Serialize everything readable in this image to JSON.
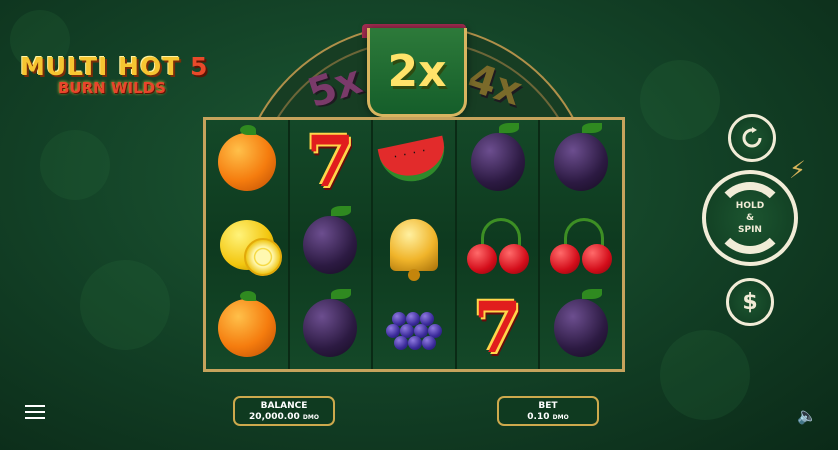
{
  "game": {
    "title_main": "MULTI HOT",
    "title_number": "5",
    "title_sub": "BURN WILDS"
  },
  "multipliers": {
    "left_edge": "",
    "five": "5x",
    "active": "2x",
    "four": "4x",
    "three": ""
  },
  "reels": [
    [
      "orange",
      "lemon",
      "orange"
    ],
    [
      "seven",
      "plum",
      "plum"
    ],
    [
      "watermelon",
      "bell",
      "grapes"
    ],
    [
      "plum",
      "cherry",
      "seven"
    ],
    [
      "plum",
      "cherry",
      "plum"
    ]
  ],
  "symbols": {
    "seven": "7"
  },
  "controls": {
    "spin_label_1": "HOLD",
    "spin_label_2": "&",
    "spin_label_3": "SPIN",
    "autoplay_icon": "autoplay-icon",
    "coin_symbol": "$",
    "bolt_icon": "⚡",
    "sound_icon": "🔈"
  },
  "footer": {
    "balance_label": "BALANCE",
    "balance_value": "20,000.00",
    "balance_unit": "DMO",
    "bet_label": "BET",
    "bet_value": "0.10",
    "bet_unit": "DMO"
  }
}
